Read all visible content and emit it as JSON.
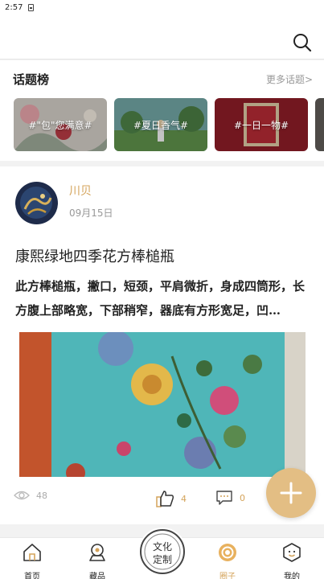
{
  "status_bar": {
    "time": "2:57"
  },
  "header": {
    "search_icon": "search-icon"
  },
  "topics": {
    "title": "话题榜",
    "more": "更多话题>",
    "items": [
      {
        "label": "#\"包\"您满意#"
      },
      {
        "label": "#夏日香气#"
      },
      {
        "label": "#一日一物#"
      }
    ]
  },
  "post": {
    "author": "川贝",
    "date": "09月15日",
    "title": "康熙绿地四季花方棒槌瓶",
    "body": "此方棒槌瓶，撇口，短颈，平肩微折，身成四筒形，长方腹上部略宽，下部稍窄，器底有方形宽足，凹…",
    "views": "48",
    "likes": "4",
    "comments": "0"
  },
  "fab": {
    "icon": "plus-icon"
  },
  "tab_bar": {
    "items": [
      {
        "label": "首页",
        "icon": "home-icon"
      },
      {
        "label": "藏品",
        "icon": "collection-icon"
      },
      {
        "label": "圈子",
        "icon": "circle-icon"
      },
      {
        "label": "我的",
        "icon": "profile-icon"
      }
    ],
    "center_label_top": "文化",
    "center_label_bottom": "定制",
    "active_index": 2
  },
  "colors": {
    "accent": "#d4a35a",
    "fab": "#e3be84",
    "background": "#f2f2f2"
  }
}
